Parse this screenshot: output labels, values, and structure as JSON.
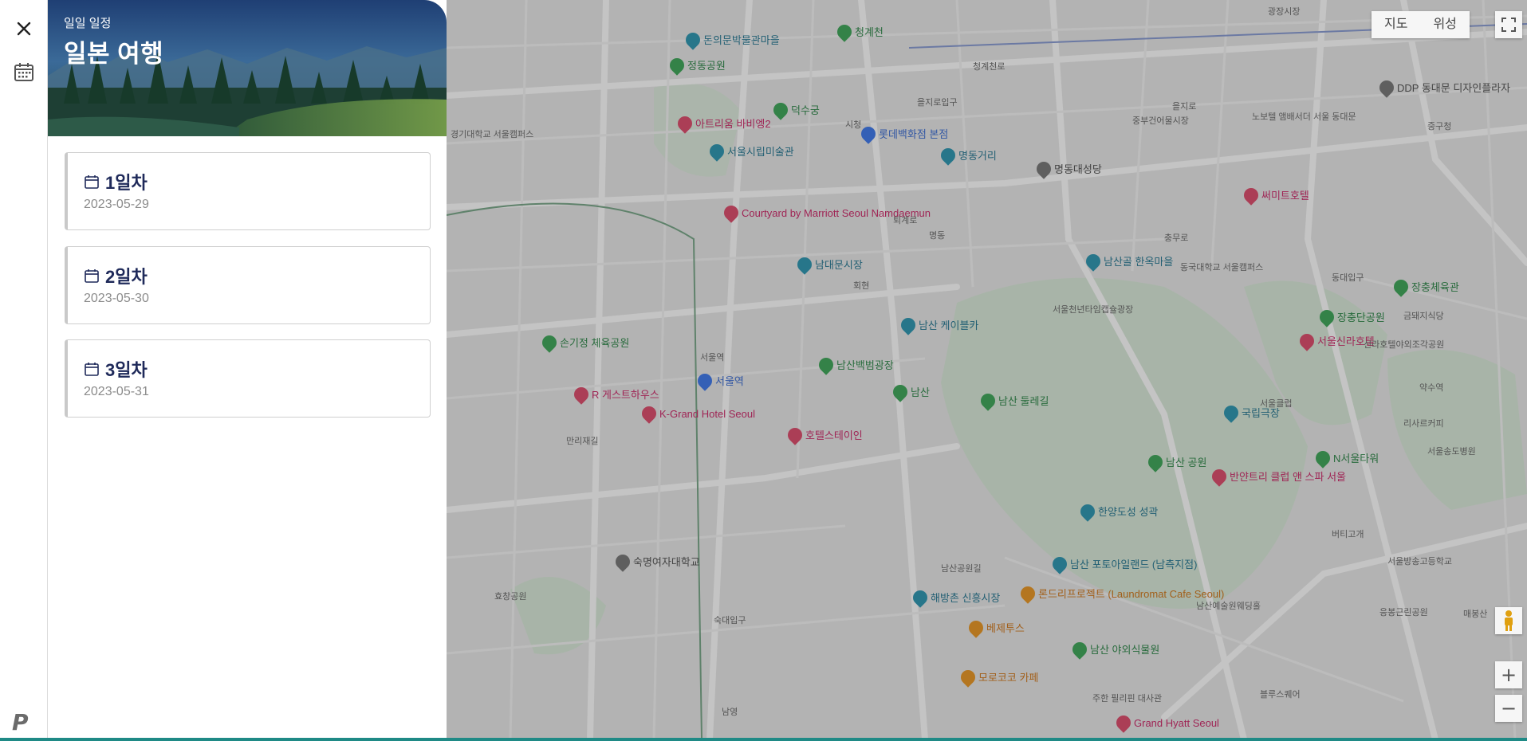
{
  "trip": {
    "subtitle": "일일 일정",
    "title": "일본 여행"
  },
  "days": [
    {
      "label": "1일차",
      "date": "2023-05-29"
    },
    {
      "label": "2일차",
      "date": "2023-05-30"
    },
    {
      "label": "3일차",
      "date": "2023-05-31"
    }
  ],
  "map": {
    "view_map": "지도",
    "view_satellite": "위성",
    "pois": {
      "namsan_tower": "N서울타워",
      "namsan_park": "남산 공원",
      "namdaemun": "남대문시장",
      "seoul_station": "서울역",
      "deoksugung": "덕수궁",
      "myeongdong": "명동거리",
      "myeongdong_cathedral": "명동대성당",
      "courtyard": "Courtyard by Marriott Seoul Namdaemun",
      "k_grand": "K-Grand Hotel Seoul",
      "hotel_stein": "호텔스테이인",
      "grand_hyatt": "Grand Hyatt Seoul",
      "shilla": "서울신라호텔",
      "hanok": "남산골 한옥마을",
      "cable": "남산 케이블카",
      "baekbeom": "남산백범광장",
      "namsan": "남산",
      "dullegil": "남산 둘레길",
      "hanyang": "한양도성 성곽",
      "botanical": "남산 야외식물원",
      "laundromat": "론드리프로젝트 (Laundromat Cafe Seoul)",
      "beteto": "베제투스",
      "morococo": "모로코코 카페",
      "ddp": "DDP 동대문 디자인플라자",
      "jangchung": "장충체육관",
      "jangchung_park": "장충단공원",
      "national_theater": "국립극장",
      "banyan": "반얀트리 클럽 앤 스파 서울",
      "summit": "써미트호텔",
      "sookmyung": "숙명여자대학교",
      "museum": "돈의문박물관마을",
      "jeongdong": "정동공원",
      "art_museum": "서울시립미술관",
      "lotte": "롯데백화점 본점",
      "cheonggye": "청계천",
      "sonkijeong": "손기정 체육공원",
      "r_guesthouse": "R 게스트하우스",
      "artrium": "아트리움 바비엥2",
      "haebangchon": "해방촌 신흥시장",
      "namsan_tower_observatory": "남산 포토아일랜드 (남측지점)"
    },
    "labels": {
      "l1": "서울천년타임캡슐광장",
      "l2": "동국대학교 서울캠퍼스",
      "l3": "경기대학교 서울캠퍼스",
      "l4": "중부건어물시장",
      "l5": "노보텔 앰배서더 서울 동대문",
      "l6": "서울클럽",
      "l7": "신라호텔야외조각공원",
      "l8": "리사르커피",
      "l9": "서울송도병원",
      "l10": "버티고개",
      "l11": "서울방송고등학교",
      "l12": "남산예술원웨딩홀",
      "l13": "주한 필리핀 대사관",
      "l14": "블루스퀘어",
      "l15": "응봉근린공원",
      "l16": "매봉산",
      "l17": "효창공원",
      "l18": "만리재길",
      "l19": "금돼지식당",
      "l20": "광장시장",
      "l21": "퇴계로",
      "l22": "을지로",
      "l23": "청계천로",
      "l24": "충무로",
      "l25": "남산공원길",
      "l26": "서울역",
      "l27": "회현",
      "l28": "명동",
      "l29": "을지로입구",
      "l30": "시청",
      "l31": "숙대입구",
      "l32": "남영",
      "l33": "동대입구",
      "l34": "약수역",
      "l35": "중구청"
    }
  },
  "colors": {
    "accent": "#1f2a5a",
    "strip": "#1f8a86"
  },
  "icons": {
    "close": "close-icon",
    "calendar": "calendar-icon",
    "logo": "app-logo",
    "expand": "fullscreen-icon",
    "pegman": "street-view-icon",
    "zoom_in": "zoom-in-icon",
    "zoom_out": "zoom-out-icon"
  }
}
